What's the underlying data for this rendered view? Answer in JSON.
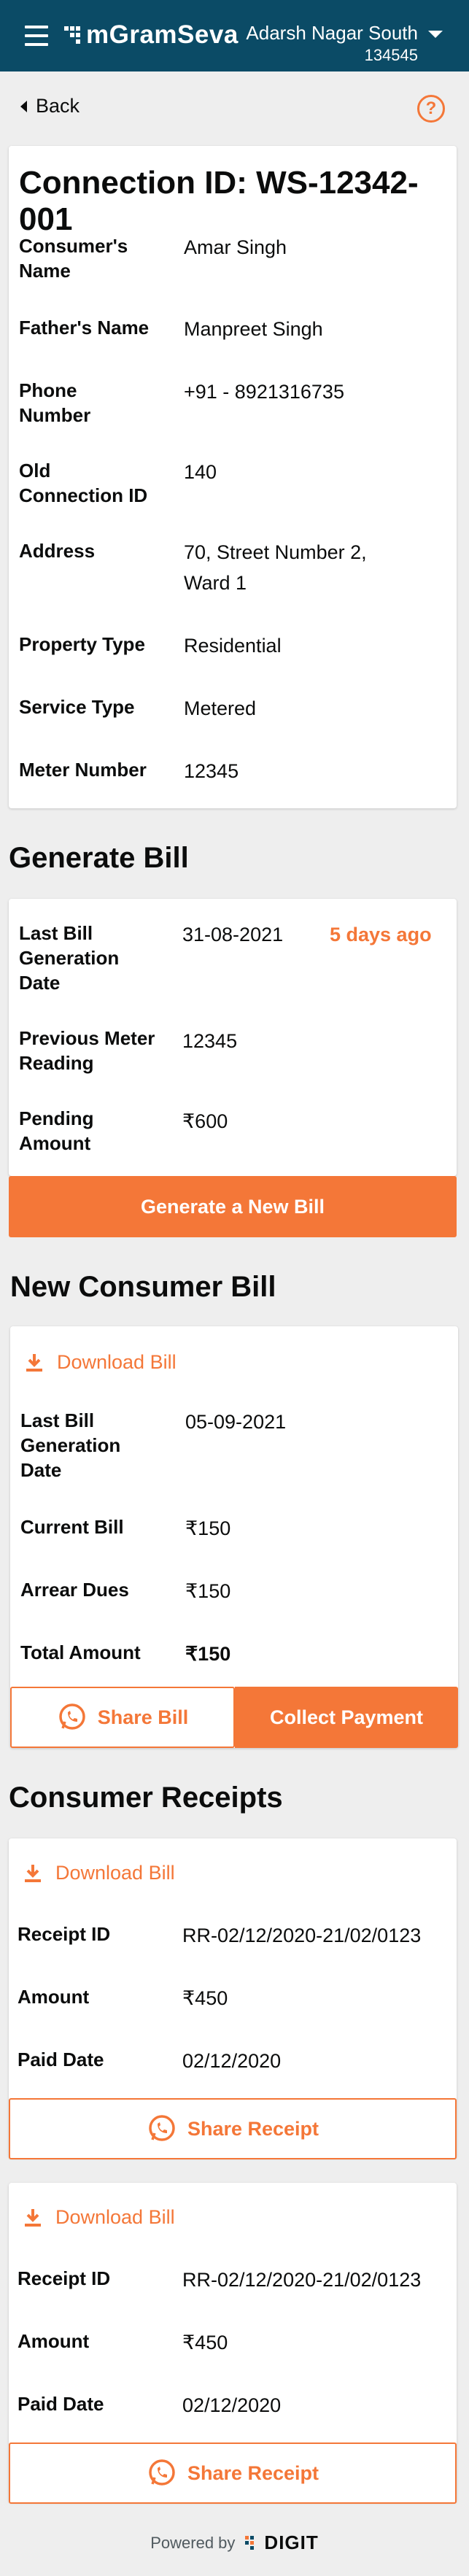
{
  "header": {
    "app_name": "mGramSeva",
    "tenant_name": "Adarsh Nagar South",
    "tenant_code": "134545",
    "icons": [
      "menu-icon",
      "logo-icon",
      "chevron-down-icon"
    ]
  },
  "nav": {
    "back_label": "Back",
    "help_icon": "?"
  },
  "connection": {
    "title": "Connection ID: WS-12342-001",
    "fields": [
      {
        "label": "Consumer's Name",
        "value": "Amar Singh"
      },
      {
        "label": "Father's Name",
        "value": "Manpreet Singh"
      },
      {
        "label": "Phone Number",
        "value": "+91 - 8921316735"
      },
      {
        "label": "Old Connection ID",
        "value": "140"
      },
      {
        "label": "Address",
        "value": "70, Street Number 2, Ward 1"
      },
      {
        "label": "Property Type",
        "value": "Residential"
      },
      {
        "label": "Service Type",
        "value": "Metered"
      },
      {
        "label": "Meter Number",
        "value": "12345"
      }
    ]
  },
  "generate_bill": {
    "title": "Generate Bill",
    "last_bill_label": "Last Bill Generation Date",
    "last_bill_value": "31-08-2021",
    "last_bill_ago": "5 days ago",
    "prev_reading_label": "Previous Meter Reading",
    "prev_reading_value": "12345",
    "pending_label": "Pending Amount",
    "pending_value": "₹600",
    "button_label": "Generate a New Bill"
  },
  "new_bill": {
    "title": "New Consumer Bill",
    "download_label": "Download Bill",
    "last_bill_label": "Last Bill Generation Date",
    "last_bill_value": "05-09-2021",
    "current_bill_label": "Current Bill",
    "current_bill_value": "₹150",
    "arrear_label": "Arrear Dues",
    "arrear_value": "₹150",
    "total_label": "Total Amount",
    "total_value": "₹150",
    "share_label": "Share Bill",
    "collect_label": "Collect Payment"
  },
  "receipts": {
    "title": "Consumer Receipts",
    "items": [
      {
        "download_label": "Download Bill",
        "receipt_id_label": "Receipt ID",
        "receipt_id": "RR-02/12/2020-21/02/0123",
        "amount_label": "Amount",
        "amount": "₹450",
        "paid_date_label": "Paid Date",
        "paid_date": "02/12/2020",
        "share_label": "Share Receipt"
      },
      {
        "download_label": "Download Bill",
        "receipt_id_label": "Receipt ID",
        "receipt_id": "RR-02/12/2020-21/02/0123",
        "amount_label": "Amount",
        "amount": "₹450",
        "paid_date_label": "Paid Date",
        "paid_date": "02/12/2020",
        "share_label": "Share Receipt"
      }
    ]
  },
  "footer": {
    "powered_by": "Powered by",
    "brand": "DIGIT"
  },
  "colors": {
    "header": "#0b4b66",
    "accent": "#f47738",
    "background": "#eeeeee"
  }
}
